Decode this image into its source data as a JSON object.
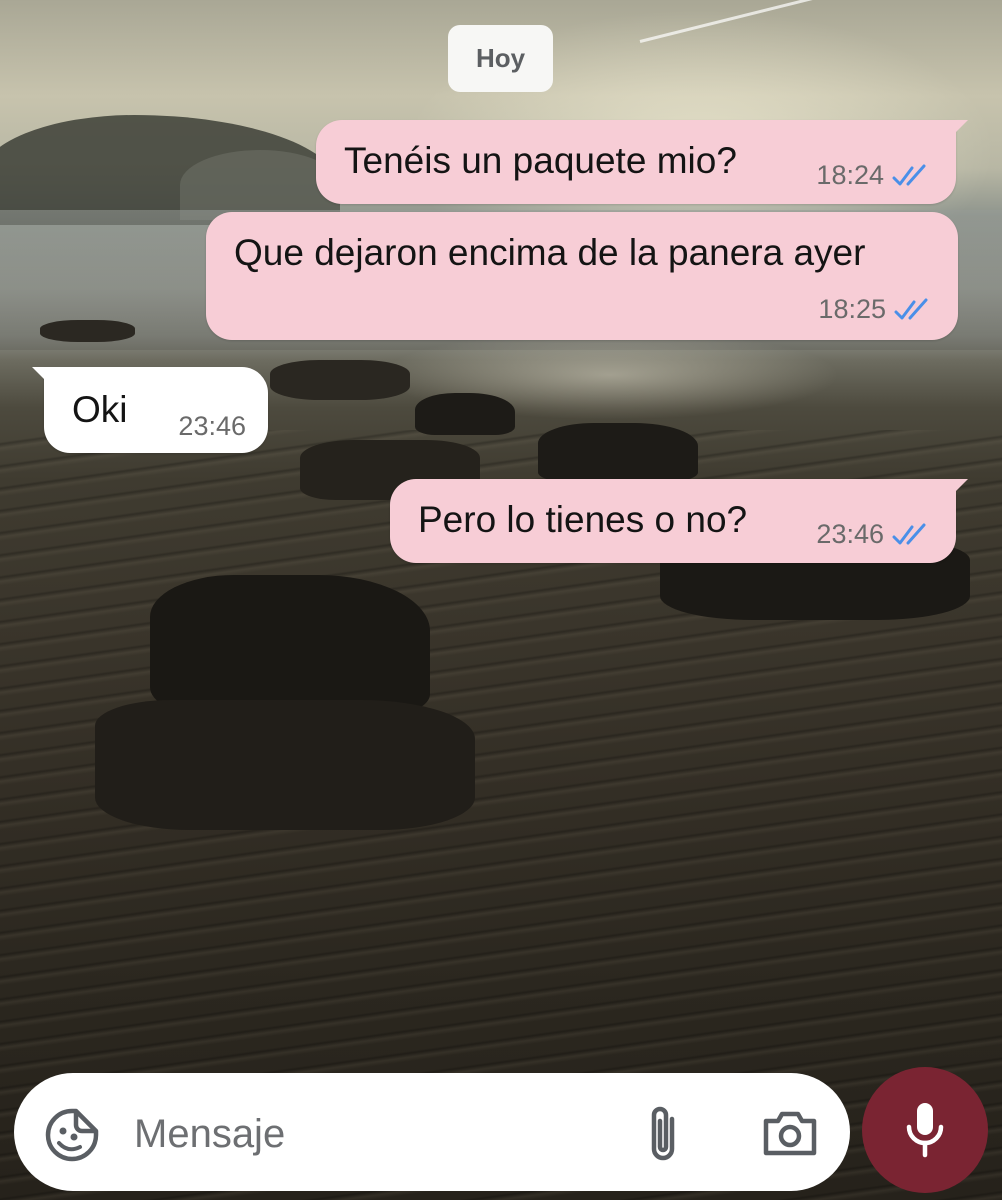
{
  "chat": {
    "date_label": "Hoy",
    "messages": [
      {
        "direction": "outgoing",
        "text": "Tenéis un paquete mio?",
        "time": "18:24",
        "status": "read"
      },
      {
        "direction": "outgoing",
        "text": "Que dejaron encima de la panera ayer",
        "time": "18:25",
        "status": "read"
      },
      {
        "direction": "incoming",
        "text": "Oki",
        "time": "23:46"
      },
      {
        "direction": "outgoing",
        "text": "Pero lo tienes o no?",
        "time": "23:46",
        "status": "read"
      }
    ]
  },
  "composer": {
    "placeholder": "Mensaje",
    "icons": {
      "emoji": "sticker-smiley-icon",
      "attach": "paperclip-icon",
      "camera": "camera-icon",
      "mic": "microphone-icon"
    }
  },
  "colors": {
    "outgoing_bubble": "#f7cdd6",
    "incoming_bubble": "#ffffff",
    "read_ticks": "#4a8fe8",
    "mic_button": "#7a2432",
    "date_pill": "#f7f7f5"
  }
}
